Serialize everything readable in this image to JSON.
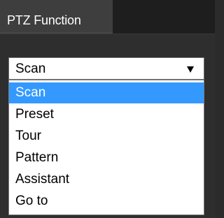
{
  "header": {
    "tab_label": "PTZ Function"
  },
  "select": {
    "value": "Scan"
  },
  "dropdown": {
    "options": [
      "Scan",
      "Preset",
      "Tour",
      "Pattern",
      "Assistant",
      "Go to"
    ],
    "selected_index": 0
  },
  "colors": {
    "highlight": "#3399ff",
    "panel_background": "#2e2e2e",
    "tab_background": "#3e3e3e"
  }
}
